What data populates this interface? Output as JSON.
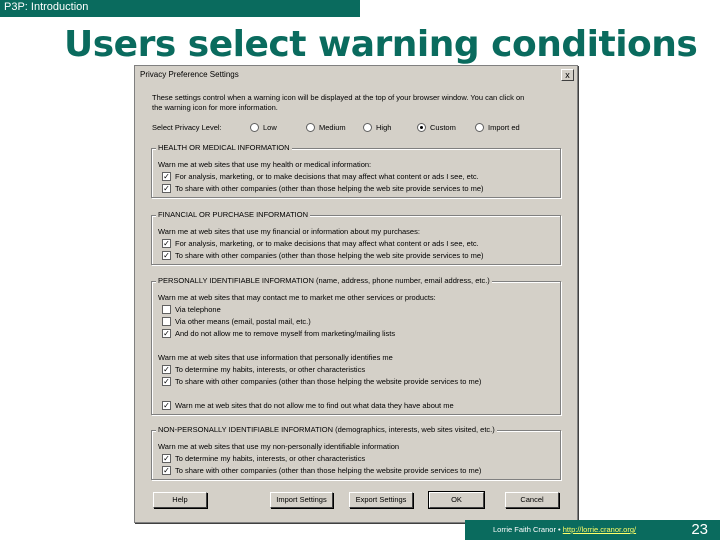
{
  "slide": {
    "section": "P3P: Introduction",
    "title": "Users select warning conditions",
    "footer_author": "Lorrie Faith Cranor • ",
    "footer_url": "http://lorrie.cranor.org/",
    "page_number": "23"
  },
  "dialog": {
    "title": "Privacy Preference Settings",
    "close_glyph": "x",
    "intro_line1": "These settings control when a warning icon will be displayed at the top of your browser window. You can click on",
    "intro_line2": "the warning icon for more information.",
    "level_label": "Select Privacy Level:",
    "levels": [
      {
        "label": "Low",
        "selected": false
      },
      {
        "label": "Medium",
        "selected": false
      },
      {
        "label": "High",
        "selected": false
      },
      {
        "label": "Custom",
        "selected": true
      },
      {
        "label": "Import ed",
        "selected": false
      }
    ],
    "health": {
      "title": "HEALTH OR MEDICAL INFORMATION",
      "prompt": "Warn me at web sites that use my health or medical information:",
      "items": [
        {
          "label": "For analysis, marketing, or to make decisions that may affect what content or ads I see, etc.",
          "checked": true
        },
        {
          "label": "To share with other companies (other than those helping the web site provide services to me)",
          "checked": true
        }
      ]
    },
    "financial": {
      "title": "FINANCIAL OR PURCHASE INFORMATION",
      "prompt": "Warn me at web sites that use my financial or information about my purchases:",
      "items": [
        {
          "label": "For analysis, marketing, or to make decisions that may affect what content or ads I see, etc.",
          "checked": true
        },
        {
          "label": "To share with other companies (other than those helping the web site provide services to me)",
          "checked": true
        }
      ]
    },
    "personal": {
      "title": "PERSONALLY IDENTIFIABLE INFORMATION (name, address, phone number, email address, etc.)",
      "prompt1": "Warn me at web sites that may contact me to market me other services or products:",
      "items1": [
        {
          "label": "Via telephone",
          "checked": false
        },
        {
          "label": "Via other means (email, postal mail, etc.)",
          "checked": false
        },
        {
          "label": "And do not allow me to remove myself from marketing/mailing lists",
          "checked": true
        }
      ],
      "prompt2": "Warn me at web sites that use information that personally identifies me",
      "items2": [
        {
          "label": "To determine my habits, interests, or other characteristics",
          "checked": true
        },
        {
          "label": "To share with other companies (other than those helping the website provide services to me)",
          "checked": true
        }
      ],
      "item3": {
        "label": "Warn me at web sites that do not allow me to find out what data they have about me",
        "checked": true
      }
    },
    "nonpersonal": {
      "title": "NON-PERSONALLY IDENTIFIABLE INFORMATION (demographics, interests, web sites visited, etc.)",
      "prompt": "Warn me at web sites that use my non-personally identifiable information",
      "items": [
        {
          "label": "To determine my habits, interests, or other characteristics",
          "checked": true
        },
        {
          "label": "To share with other companies (other than those helping the website provide services to me)",
          "checked": true
        }
      ]
    },
    "buttons": {
      "help": "Help",
      "import": "Import Settings",
      "export": "Export Settings",
      "ok": "OK",
      "cancel": "Cancel"
    },
    "check_glyph": "✓"
  }
}
